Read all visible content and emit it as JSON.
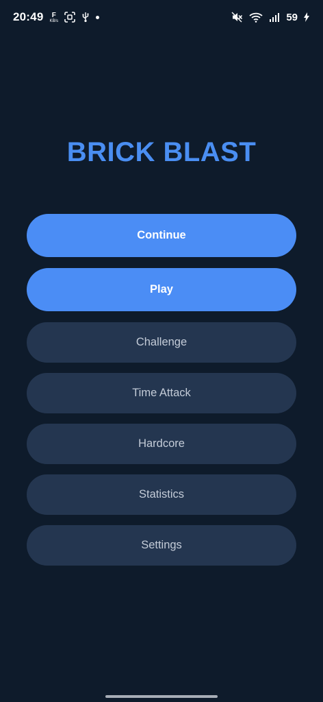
{
  "status_bar": {
    "time": "20:49",
    "speed_value": "F",
    "speed_unit": "KB/s",
    "battery": "59"
  },
  "app": {
    "title": "BRICK BLAST"
  },
  "menu": {
    "continue_label": "Continue",
    "play_label": "Play",
    "challenge_label": "Challenge",
    "time_attack_label": "Time Attack",
    "hardcore_label": "Hardcore",
    "statistics_label": "Statistics",
    "settings_label": "Settings"
  },
  "colors": {
    "background": "#0e1b2b",
    "accent": "#4b8df5",
    "title": "#4a8ef2",
    "secondary_button": "#243650",
    "secondary_text": "#c4ccd8"
  },
  "icons": [
    "screenshot-icon",
    "usb-icon",
    "notification-dot-icon",
    "mute-icon",
    "wifi-icon",
    "signal-icon",
    "charging-icon"
  ]
}
